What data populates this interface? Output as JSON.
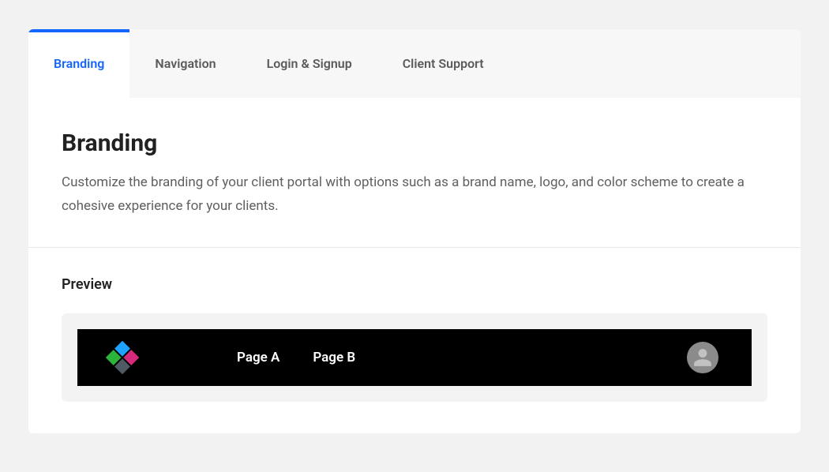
{
  "tabs": {
    "branding": "Branding",
    "navigation": "Navigation",
    "login_signup": "Login & Signup",
    "client_support": "Client Support"
  },
  "header": {
    "title": "Branding",
    "description": "Customize the branding of your client portal with options such as a brand name, logo, and color scheme to create a cohesive experience for your clients."
  },
  "preview": {
    "label": "Preview",
    "nav_links": {
      "page_a": "Page A",
      "page_b": "Page B"
    }
  }
}
